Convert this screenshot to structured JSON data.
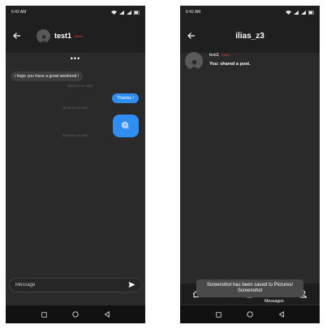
{
  "left": {
    "status_time": "6:42 AM",
    "chat": {
      "name": "test1",
      "status": "Offline",
      "typing_dots": "•••"
    },
    "messages": [
      {
        "text": "i hope you have a great weekend !",
        "timestamp": "05:04 09-12-2020"
      },
      {
        "text": "Thanks !",
        "timestamp": "05:05 09-12-2020"
      },
      {
        "image": "image-attachment-icon",
        "timestamp": "06:00 09-12-2020"
      }
    ],
    "composer": {
      "placeholder": "Message"
    }
  },
  "right": {
    "status_time": "6:42 AM",
    "title": "ilias_z3",
    "notification": {
      "username": "test1",
      "status": "Offline",
      "prefix": "You:",
      "text": "shared a post."
    },
    "bottom_nav": {
      "items": [
        "home-icon",
        "search-icon",
        "add-post-icon",
        "messages-icon",
        "profile-icon"
      ],
      "active_label": "Messages"
    },
    "toast": "Screenshot has been saved to Pictures/ Screenshot"
  },
  "colors": {
    "background": "#2a2a2a",
    "bar": "#1f1f1f",
    "accent_blue": "#2f8ff0",
    "offline_red": "#e53935"
  }
}
